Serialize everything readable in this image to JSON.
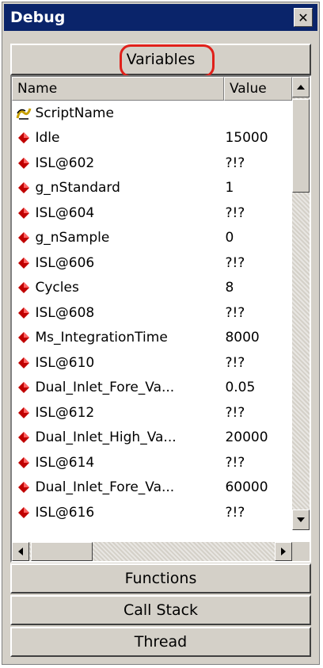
{
  "window": {
    "title": "Debug",
    "close_icon": "close-icon"
  },
  "tabs": {
    "variables": "Variables",
    "functions": "Functions",
    "call_stack": "Call Stack",
    "thread": "Thread"
  },
  "table": {
    "columns": {
      "name": "Name",
      "value": "Value"
    },
    "rows": [
      {
        "icon": "script-icon",
        "name": "ScriptName",
        "value": ""
      },
      {
        "icon": "variable-diamond-icon",
        "name": "Idle",
        "value": "15000"
      },
      {
        "icon": "variable-diamond-icon",
        "name": "ISL@602",
        "value": "?!?"
      },
      {
        "icon": "variable-diamond-icon",
        "name": "g_nStandard",
        "value": "1"
      },
      {
        "icon": "variable-diamond-icon",
        "name": "ISL@604",
        "value": "?!?"
      },
      {
        "icon": "variable-diamond-icon",
        "name": "g_nSample",
        "value": "0"
      },
      {
        "icon": "variable-diamond-icon",
        "name": "ISL@606",
        "value": "?!?"
      },
      {
        "icon": "variable-diamond-icon",
        "name": "Cycles",
        "value": "8"
      },
      {
        "icon": "variable-diamond-icon",
        "name": "ISL@608",
        "value": "?!?"
      },
      {
        "icon": "variable-diamond-icon",
        "name": "Ms_IntegrationTime",
        "value": "8000"
      },
      {
        "icon": "variable-diamond-icon",
        "name": "ISL@610",
        "value": "?!?"
      },
      {
        "icon": "variable-diamond-icon",
        "name": "Dual_Inlet_Fore_Va...",
        "value": "0.05"
      },
      {
        "icon": "variable-diamond-icon",
        "name": "ISL@612",
        "value": "?!?"
      },
      {
        "icon": "variable-diamond-icon",
        "name": "Dual_Inlet_High_Va...",
        "value": "20000"
      },
      {
        "icon": "variable-diamond-icon",
        "name": "ISL@614",
        "value": "?!?"
      },
      {
        "icon": "variable-diamond-icon",
        "name": "Dual_Inlet_Fore_Va...",
        "value": "60000"
      },
      {
        "icon": "variable-diamond-icon",
        "name": "ISL@616",
        "value": "?!?"
      }
    ]
  },
  "colors": {
    "titlebar": "#0a246a",
    "diamond": "#c00000",
    "highlight": "#e0201a"
  }
}
